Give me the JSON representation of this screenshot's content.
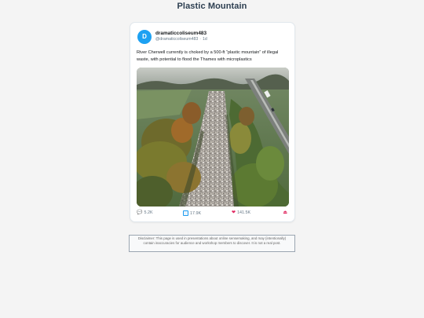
{
  "page": {
    "title": "Plastic Mountain"
  },
  "post": {
    "avatar_initial": "D",
    "username": "dramaticcoliseum483",
    "handle": "@dramaticcoliseum483",
    "separator": "·",
    "time": "1d",
    "text": "River Cherwell currently is choked by a 500-ft “plastic mountain” of illegal waste, with potential to flood the Thames with microplastics",
    "media_icon": "aerial-photo-waste-strip",
    "actions": {
      "reply_icon": "speech-bubble-icon",
      "reply_count": "5.2K",
      "retweet_icon": "retweet-icon",
      "retweet_count": "17.9K",
      "like_icon": "heart-icon",
      "like_count": "141.5K",
      "share_icon": "share-icon"
    }
  },
  "disclaimer": "Disclaimer: This page is used in presentations about online sensemaking, and may (intentionally) contain inaccuracies for audience and workshop members to discover. It is not a real post.",
  "colors": {
    "accent": "#1da1f2",
    "like": "#e0245e",
    "title": "#2c3e50"
  }
}
